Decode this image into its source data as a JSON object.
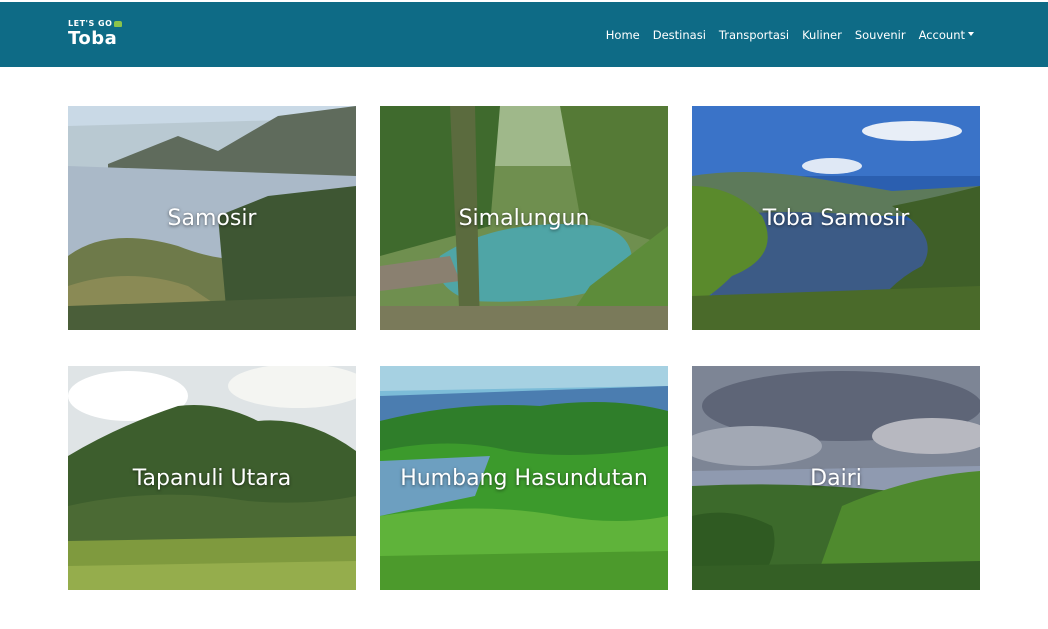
{
  "brand": {
    "line1": "LET'S GO",
    "line2": "Toba"
  },
  "nav": {
    "home": "Home",
    "destinasi": "Destinasi",
    "transportasi": "Transportasi",
    "kuliner": "Kuliner",
    "souvenir": "Souvenir",
    "account": "Account"
  },
  "destinations": [
    {
      "name": "Samosir"
    },
    {
      "name": "Simalungun"
    },
    {
      "name": "Toba Samosir"
    },
    {
      "name": "Tapanuli Utara"
    },
    {
      "name": "Humbang Hasundutan"
    },
    {
      "name": "Dairi"
    }
  ],
  "colors": {
    "navbar": "#0e6b86",
    "text_on_dark": "#ffffff"
  }
}
